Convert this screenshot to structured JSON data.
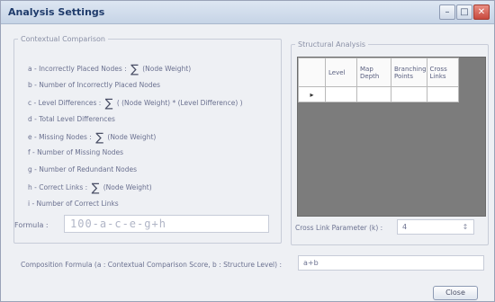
{
  "window": {
    "title": "Analysis Settings"
  },
  "left_panel": {
    "legend": "Contextual Comparison",
    "lines": [
      {
        "prefix": "a - Incorrectly Placed Nodes :",
        "sigma": "∑",
        "suffix": "(Node Weight)"
      },
      {
        "prefix": "b - Number of Incorrectly Placed Nodes",
        "sigma": "",
        "suffix": ""
      },
      {
        "prefix": "c - Level Differences :",
        "sigma": "∑",
        "suffix": "( (Node Weight) * (Level Difference) )"
      },
      {
        "prefix": "d - Total Level Differences",
        "sigma": "",
        "suffix": ""
      },
      {
        "prefix": "e - Missing Nodes :",
        "sigma": "∑",
        "suffix": "(Node Weight)"
      },
      {
        "prefix": "f - Number of Missing Nodes",
        "sigma": "",
        "suffix": ""
      },
      {
        "prefix": "g - Number of Redundant Nodes",
        "sigma": "",
        "suffix": ""
      },
      {
        "prefix": "h - Correct Links :",
        "sigma": "∑",
        "suffix": "(Node Weight)"
      },
      {
        "prefix": "i - Number of Correct Links",
        "sigma": "",
        "suffix": ""
      }
    ],
    "formula_label": "Formula :",
    "formula_value": "100-a-c-e-g+h"
  },
  "right_panel": {
    "legend": "Structural Analysis",
    "columns": [
      "Level",
      "Map Depth",
      "Branching Points",
      "Cross Links"
    ],
    "row_marker": "▸",
    "cross_link_label": "Cross Link Parameter (k) :",
    "cross_link_value": "4",
    "spin_glyph": "↕"
  },
  "composition": {
    "label": "Composition Formula (a : Contextual Comparison Score, b : Structure Level) :",
    "value": "a+b"
  },
  "buttons": {
    "close": "Close"
  },
  "icons": {
    "minimize": "–",
    "maximize": "□",
    "close": "✕"
  }
}
